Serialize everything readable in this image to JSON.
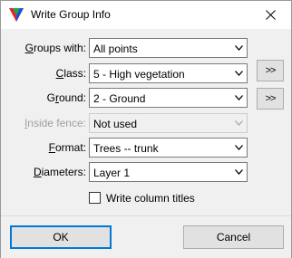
{
  "window": {
    "title": "Write Group Info"
  },
  "icons": {
    "app": "app-triangle-icon",
    "close": "close-icon",
    "dropdown": "chevron-down-icon"
  },
  "colors": {
    "ok_focus": "#0078d7",
    "icon_red": "#e8222d",
    "icon_blue": "#1f4fd8",
    "icon_green": "#1fa84a"
  },
  "form": {
    "groups_with": {
      "label_accel": "G",
      "label_rest": "roups with:",
      "value": "All points"
    },
    "class": {
      "label_accel": "C",
      "label_rest": "lass:",
      "value": "5 - High vegetation"
    },
    "ground": {
      "label_pre": "G",
      "label_accel": "r",
      "label_rest": "ound:",
      "value": "2 - Ground"
    },
    "inside_fence": {
      "label_accel": "I",
      "label_rest": "nside fence:",
      "value": "Not used",
      "disabled": true
    },
    "format": {
      "label_accel": "F",
      "label_rest": "ormat:",
      "value": "Trees -- trunk"
    },
    "diameters": {
      "label_accel": "D",
      "label_rest": "iameters:",
      "value": "Layer 1"
    },
    "write_column_titles": {
      "label": "Write column titles",
      "checked": false
    }
  },
  "side_buttons": {
    "class_more": ">>",
    "ground_more": ">>"
  },
  "buttons": {
    "ok": "OK",
    "cancel": "Cancel"
  }
}
